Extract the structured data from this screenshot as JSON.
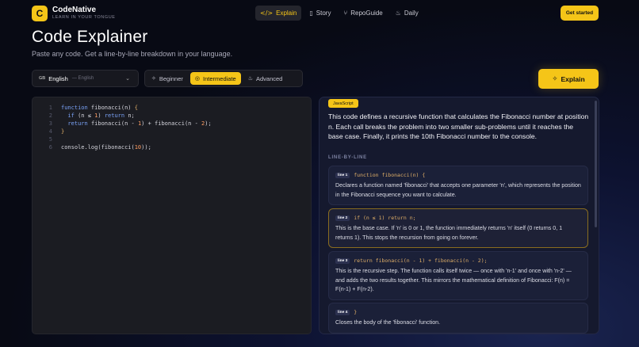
{
  "brand": {
    "logo_letter": "C",
    "name": "CodeNative",
    "tagline": "LEARN IN YOUR TONGUE"
  },
  "nav": [
    {
      "icon": "code-icon",
      "glyph": "</>",
      "label": "Explain",
      "active": true
    },
    {
      "icon": "book-icon",
      "glyph": "▯",
      "label": "Story",
      "active": false
    },
    {
      "icon": "branch-icon",
      "glyph": "⑂",
      "label": "RepoGuide",
      "active": false
    },
    {
      "icon": "flame-icon",
      "glyph": "♨",
      "label": "Daily",
      "active": false
    }
  ],
  "header": {
    "cta": "Get started",
    "title": "Code Explainer",
    "subtitle": "Paste any code. Get a line-by-line breakdown in your language."
  },
  "language_select": {
    "code": "GB",
    "name": "English",
    "native": "— English"
  },
  "levels": [
    {
      "icon": "sparkle-icon",
      "glyph": "✧",
      "label": "Beginner",
      "active": false
    },
    {
      "icon": "target-icon",
      "glyph": "◎",
      "label": "Intermediate",
      "active": true
    },
    {
      "icon": "flame-icon",
      "glyph": "♨",
      "label": "Advanced",
      "active": false
    }
  ],
  "explain_button": {
    "label": "Explain",
    "icon": "sparkle-icon"
  },
  "editor": {
    "line_numbers": [
      "1",
      "2",
      "3",
      "4",
      "5",
      "6"
    ]
  },
  "explanation": {
    "language_badge": "JavaScript",
    "summary": "This code defines a recursive function that calculates the Fibonacci number at position n. Each call breaks the problem into two smaller sub-problems until it reaches the base case. Finally, it prints the 10th Fibonacci number to the console.",
    "section_heading": "LINE-BY-LINE",
    "items": [
      {
        "tag": "line 1",
        "code": "function fibonacci(n) {",
        "text": "Declares a function named 'fibonacci' that accepts one parameter 'n', which represents the position in the Fibonacci sequence you want to calculate."
      },
      {
        "tag": "line 2",
        "code": "if (n ≤ 1) return n;",
        "text": "This is the base case. If 'n' is 0 or 1, the function immediately returns 'n' itself (0 returns 0, 1 returns 1). This stops the recursion from going on forever."
      },
      {
        "tag": "line 3",
        "code": "return fibonacci(n - 1) + fibonacci(n - 2);",
        "text": "This is the recursive step. The function calls itself twice — once with 'n-1' and once with 'n-2' — and adds the two results together. This mirrors the mathematical definition of Fibonacci: F(n) = F(n-1) + F(n-2)."
      },
      {
        "tag": "line 4",
        "code": "}",
        "text": "Closes the body of the 'fibonacci' function."
      }
    ]
  },
  "colors": {
    "accent": "#f5c518",
    "background": "#0b0d1a",
    "panel": "#15192e",
    "editor": "#1b1c22"
  }
}
